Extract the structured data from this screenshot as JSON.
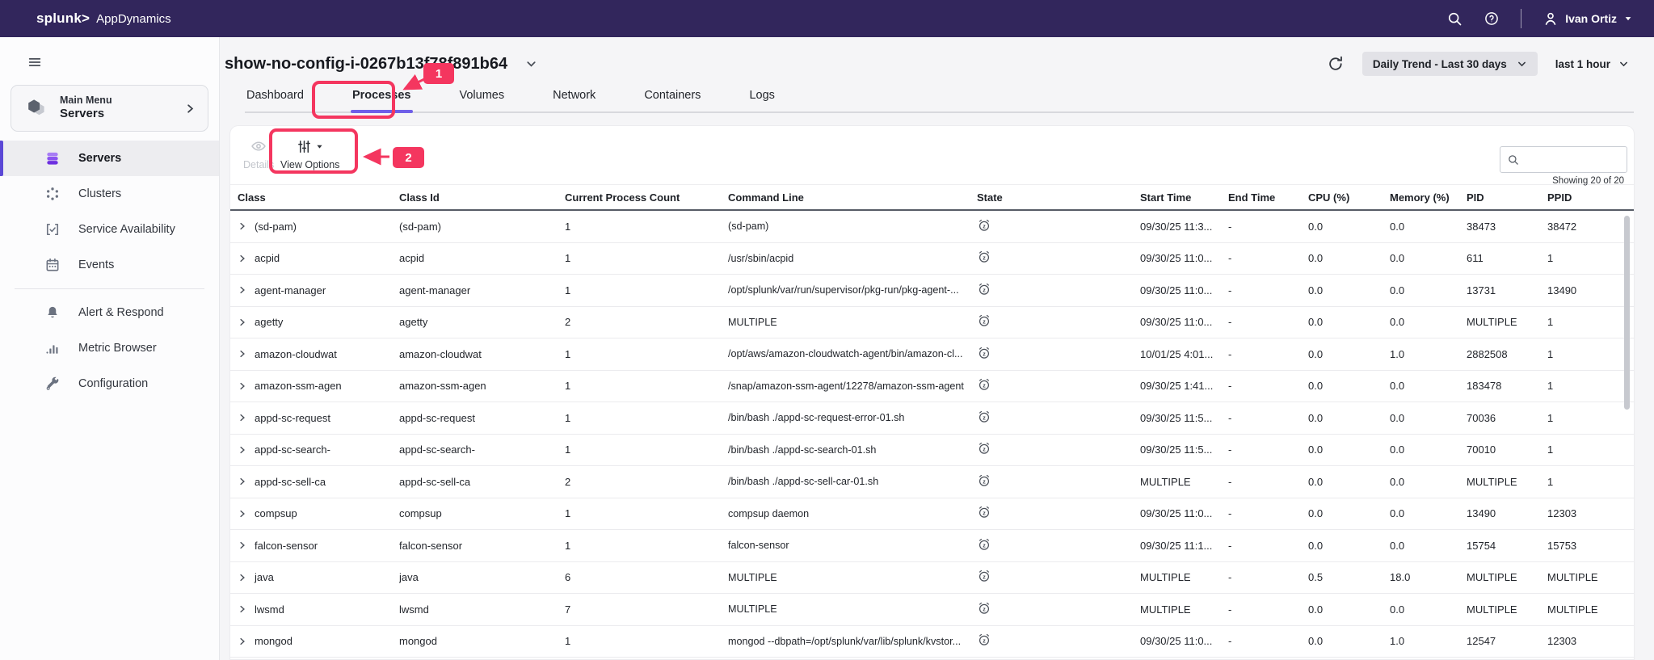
{
  "topbar": {
    "brand_splunk": "splunk>",
    "brand_app": "AppDynamics",
    "user_name": "Ivan Ortiz"
  },
  "page": {
    "title": "show-no-config-i-0267b13f78f891b64",
    "trend_selector": "Daily Trend - Last 30 days",
    "time_range": "last 1 hour"
  },
  "sidebar": {
    "main_menu_label": "Main Menu",
    "main_menu_value": "Servers",
    "items": [
      {
        "label": "Servers",
        "icon": "database-icon",
        "selected": true,
        "divider_before": false
      },
      {
        "label": "Clusters",
        "icon": "clusters-icon",
        "selected": false,
        "divider_before": false
      },
      {
        "label": "Service Availability",
        "icon": "service-availability-icon",
        "selected": false,
        "divider_before": false
      },
      {
        "label": "Events",
        "icon": "calendar-icon",
        "selected": false,
        "divider_before": false
      },
      {
        "label": "Alert & Respond",
        "icon": "bell-icon",
        "selected": false,
        "divider_before": true
      },
      {
        "label": "Metric Browser",
        "icon": "bar-chart-icon",
        "selected": false,
        "divider_before": false
      },
      {
        "label": "Configuration",
        "icon": "wrench-icon",
        "selected": false,
        "divider_before": false
      }
    ]
  },
  "tabs": {
    "active": "Processes",
    "items": [
      "Dashboard",
      "Processes",
      "Volumes",
      "Network",
      "Containers",
      "Logs"
    ]
  },
  "toolbar": {
    "details_label": "Details",
    "view_options_label": "View Options",
    "search_value": ""
  },
  "annotations": {
    "step1": "1",
    "step2": "2"
  },
  "table": {
    "showing": "Showing 20 of 20",
    "columns": [
      "Class",
      "Class Id",
      "Current Process Count",
      "Command Line",
      "State",
      "Start Time",
      "End Time",
      "CPU (%)",
      "Memory (%)",
      "PID",
      "PPID"
    ],
    "rows": [
      {
        "class": "(sd-pam)",
        "class_id": "(sd-pam)",
        "count": "1",
        "command": "(sd-pam)",
        "state": "sleeping",
        "start_time": "09/30/25 11:3...",
        "end_time": "-",
        "cpu": "0.0",
        "memory": "0.0",
        "pid": "38473",
        "ppid": "38472"
      },
      {
        "class": "acpid",
        "class_id": "acpid",
        "count": "1",
        "command": "/usr/sbin/acpid",
        "state": "sleeping",
        "start_time": "09/30/25 11:0...",
        "end_time": "-",
        "cpu": "0.0",
        "memory": "0.0",
        "pid": "611",
        "ppid": "1"
      },
      {
        "class": "agent-manager",
        "class_id": "agent-manager",
        "count": "1",
        "command": "/opt/splunk/var/run/supervisor/pkg-run/pkg-agent-...",
        "state": "sleeping",
        "start_time": "09/30/25 11:0...",
        "end_time": "-",
        "cpu": "0.0",
        "memory": "0.0",
        "pid": "13731",
        "ppid": "13490"
      },
      {
        "class": "agetty",
        "class_id": "agetty",
        "count": "2",
        "command": "MULTIPLE",
        "state": "sleeping",
        "start_time": "09/30/25 11:0...",
        "end_time": "-",
        "cpu": "0.0",
        "memory": "0.0",
        "pid": "MULTIPLE",
        "ppid": "1"
      },
      {
        "class": "amazon-cloudwat",
        "class_id": "amazon-cloudwat",
        "count": "1",
        "command": "/opt/aws/amazon-cloudwatch-agent/bin/amazon-cl...",
        "state": "sleeping",
        "start_time": "10/01/25 4:01...",
        "end_time": "-",
        "cpu": "0.0",
        "memory": "1.0",
        "pid": "2882508",
        "ppid": "1"
      },
      {
        "class": "amazon-ssm-agen",
        "class_id": "amazon-ssm-agen",
        "count": "1",
        "command": "/snap/amazon-ssm-agent/12278/amazon-ssm-agent",
        "state": "sleeping",
        "start_time": "09/30/25 1:41...",
        "end_time": "-",
        "cpu": "0.0",
        "memory": "0.0",
        "pid": "183478",
        "ppid": "1"
      },
      {
        "class": "appd-sc-request",
        "class_id": "appd-sc-request",
        "count": "1",
        "command": "/bin/bash ./appd-sc-request-error-01.sh",
        "state": "sleeping",
        "start_time": "09/30/25 11:5...",
        "end_time": "-",
        "cpu": "0.0",
        "memory": "0.0",
        "pid": "70036",
        "ppid": "1"
      },
      {
        "class": "appd-sc-search-",
        "class_id": "appd-sc-search-",
        "count": "1",
        "command": "/bin/bash ./appd-sc-search-01.sh",
        "state": "sleeping",
        "start_time": "09/30/25 11:5...",
        "end_time": "-",
        "cpu": "0.0",
        "memory": "0.0",
        "pid": "70010",
        "ppid": "1"
      },
      {
        "class": "appd-sc-sell-ca",
        "class_id": "appd-sc-sell-ca",
        "count": "2",
        "command": "/bin/bash ./appd-sc-sell-car-01.sh",
        "state": "sleeping",
        "start_time": "MULTIPLE",
        "end_time": "-",
        "cpu": "0.0",
        "memory": "0.0",
        "pid": "MULTIPLE",
        "ppid": "1"
      },
      {
        "class": "compsup",
        "class_id": "compsup",
        "count": "1",
        "command": "compsup daemon",
        "state": "sleeping",
        "start_time": "09/30/25 11:0...",
        "end_time": "-",
        "cpu": "0.0",
        "memory": "0.0",
        "pid": "13490",
        "ppid": "12303"
      },
      {
        "class": "falcon-sensor",
        "class_id": "falcon-sensor",
        "count": "1",
        "command": "falcon-sensor",
        "state": "sleeping",
        "start_time": "09/30/25 11:1...",
        "end_time": "-",
        "cpu": "0.0",
        "memory": "0.0",
        "pid": "15754",
        "ppid": "15753"
      },
      {
        "class": "java",
        "class_id": "java",
        "count": "6",
        "command": "MULTIPLE",
        "state": "sleeping",
        "start_time": "MULTIPLE",
        "end_time": "-",
        "cpu": "0.5",
        "memory": "18.0",
        "pid": "MULTIPLE",
        "ppid": "MULTIPLE"
      },
      {
        "class": "lwsmd",
        "class_id": "lwsmd",
        "count": "7",
        "command": "MULTIPLE",
        "state": "sleeping",
        "start_time": "MULTIPLE",
        "end_time": "-",
        "cpu": "0.0",
        "memory": "0.0",
        "pid": "MULTIPLE",
        "ppid": "MULTIPLE"
      },
      {
        "class": "mongod",
        "class_id": "mongod",
        "count": "1",
        "command": "mongod --dbpath=/opt/splunk/var/lib/splunk/kvstor...",
        "state": "sleeping",
        "start_time": "09/30/25 11:0...",
        "end_time": "-",
        "cpu": "0.0",
        "memory": "1.0",
        "pid": "12547",
        "ppid": "12303"
      }
    ]
  }
}
